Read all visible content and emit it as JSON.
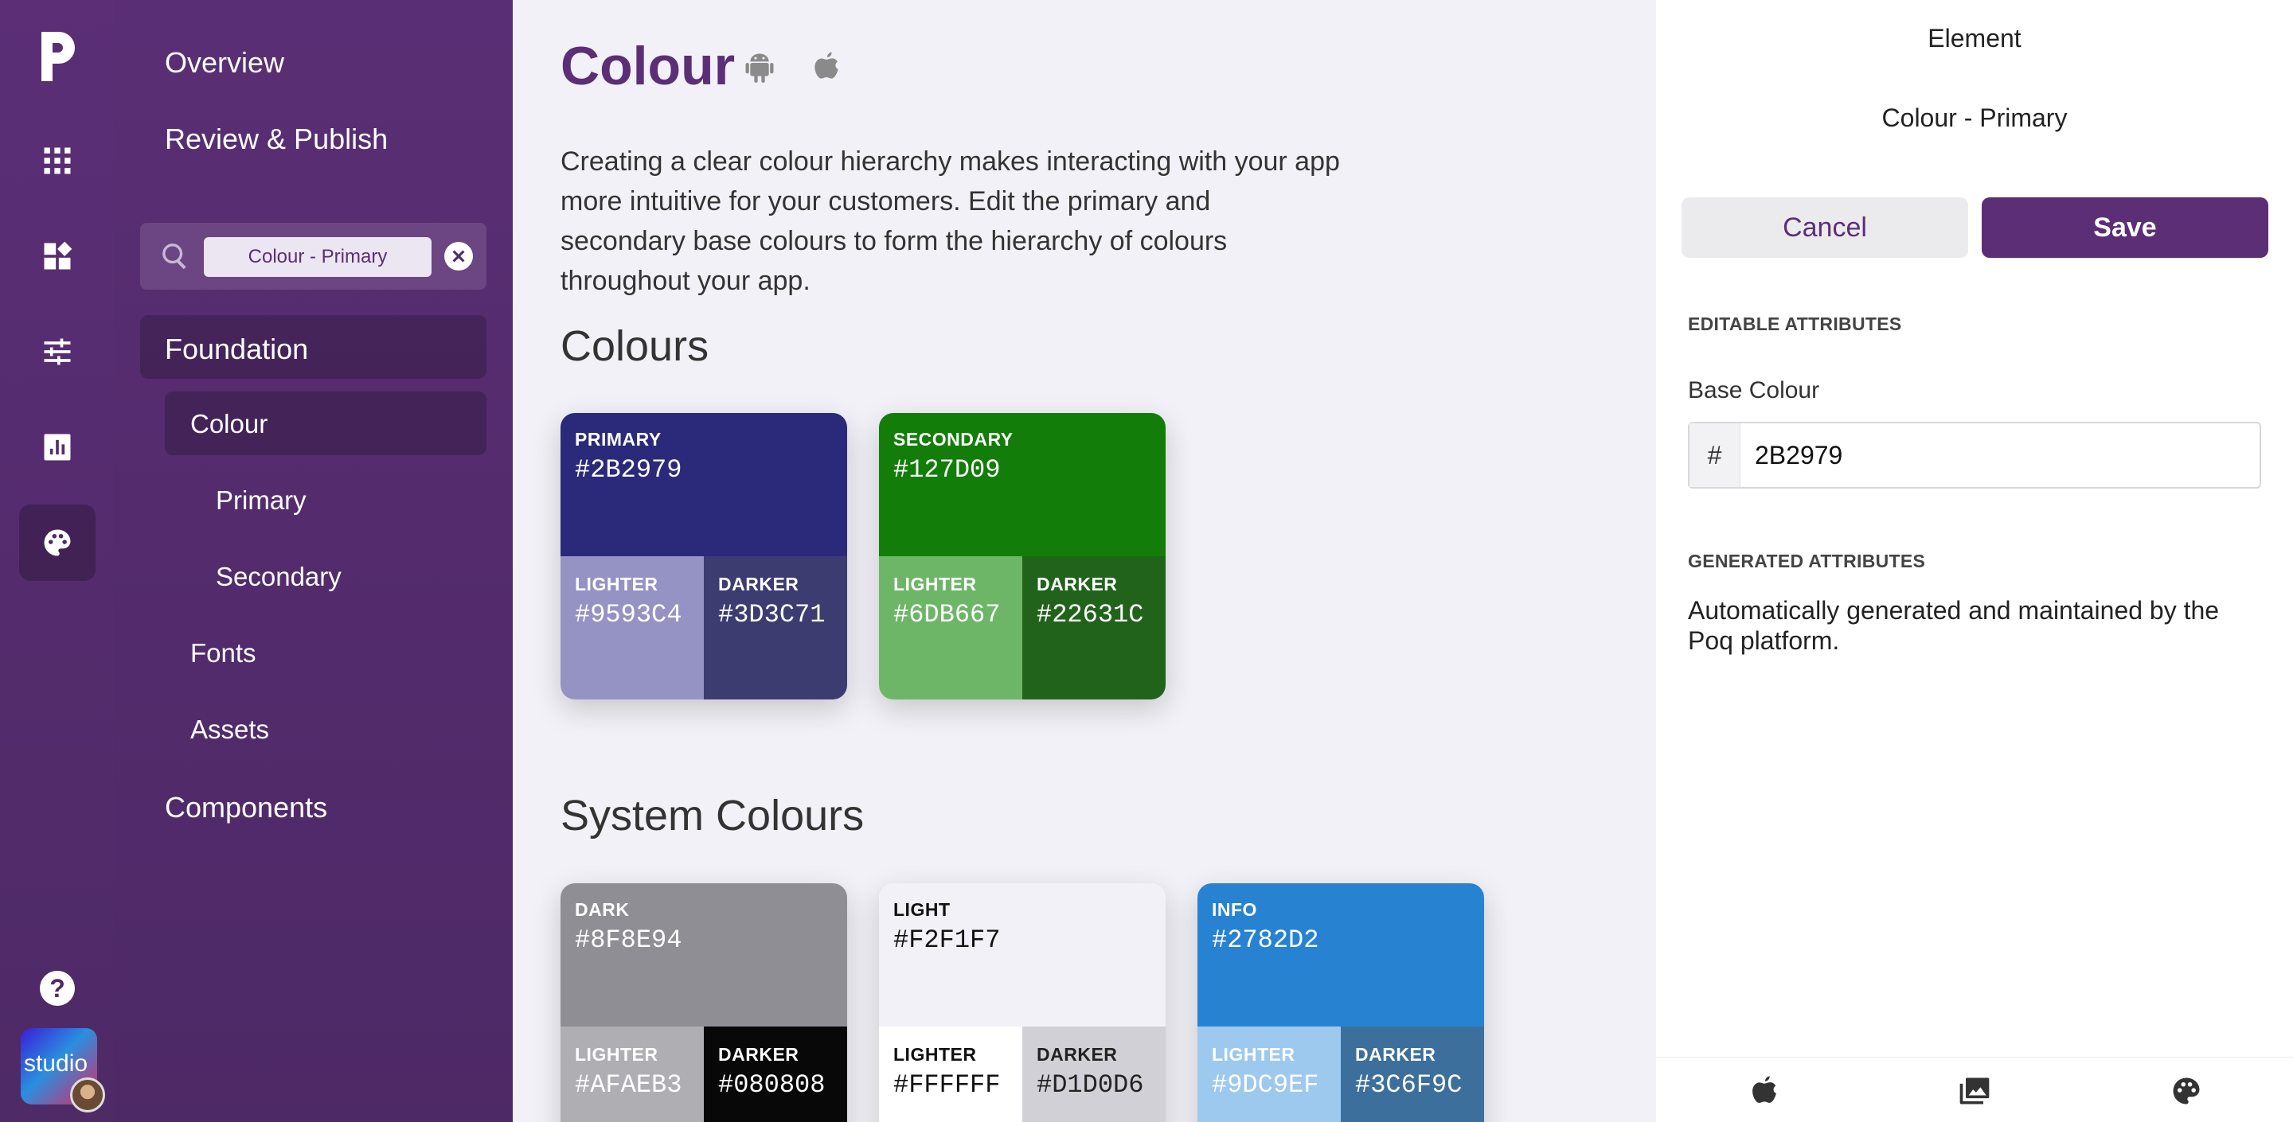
{
  "rail": {
    "logo": "poq-logo-icon",
    "items": [
      "apps-grid-icon",
      "dashboard-icon",
      "sliders-icon",
      "analytics-icon",
      "palette-icon"
    ],
    "help": "help-icon",
    "studio_badge": "studio"
  },
  "nav": {
    "overview": "Overview",
    "review_publish": "Review & Publish",
    "search_chip": "Colour - Primary",
    "foundation": "Foundation",
    "colour": "Colour",
    "primary": "Primary",
    "secondary": "Secondary",
    "fonts": "Fonts",
    "assets": "Assets",
    "components": "Components"
  },
  "main": {
    "title": "Colour",
    "intro": "Creating a clear colour hierarchy makes interacting with your app more intuitive for your customers. Edit the primary and secondary base colours to form the hierarchy of colours throughout your app.",
    "colours_heading": "Colours",
    "system_heading": "System Colours",
    "colours": [
      {
        "name": "PRIMARY",
        "hex": "#2B2979",
        "color": "#2B2979",
        "text": "#ffffff",
        "lighter": {
          "label": "LIGHTER",
          "hex": "#9593C4",
          "color": "#9593C4",
          "text": "#ffffff"
        },
        "darker": {
          "label": "DARKER",
          "hex": "#3D3C71",
          "color": "#3D3C71",
          "text": "#ffffff"
        }
      },
      {
        "name": "SECONDARY",
        "hex": "#127D09",
        "color": "#127D09",
        "text": "#ffffff",
        "lighter": {
          "label": "LIGHTER",
          "hex": "#6DB667",
          "color": "#6DB667",
          "text": "#ffffff"
        },
        "darker": {
          "label": "DARKER",
          "hex": "#22631C",
          "color": "#22631C",
          "text": "#ffffff"
        }
      }
    ],
    "system": [
      {
        "name": "DARK",
        "hex": "#8F8E94",
        "color": "#8F8E94",
        "text": "#ffffff",
        "lighter": {
          "label": "LIGHTER",
          "hex": "#AFAEB3",
          "color": "#AFAEB3",
          "text": "#ffffff"
        },
        "darker": {
          "label": "DARKER",
          "hex": "#080808",
          "color": "#080808",
          "text": "#ffffff"
        }
      },
      {
        "name": "LIGHT",
        "hex": "#F2F1F7",
        "color": "#F2F1F7",
        "text": "#111111",
        "lighter": {
          "label": "LIGHTER",
          "hex": "#FFFFFF",
          "color": "#FFFFFF",
          "text": "#111111"
        },
        "darker": {
          "label": "DARKER",
          "hex": "#D1D0D6",
          "color": "#D1D0D6",
          "text": "#222222"
        }
      },
      {
        "name": "INFO",
        "hex": "#2782D2",
        "color": "#2782D2",
        "text": "#ffffff",
        "lighter": {
          "label": "LIGHTER",
          "hex": "#9DC9EF",
          "color": "#9DC9EF",
          "text": "#ffffff"
        },
        "darker": {
          "label": "DARKER",
          "hex": "#3C6F9C",
          "color": "#3C6F9C",
          "text": "#ffffff"
        }
      }
    ]
  },
  "panel": {
    "heading": "Element",
    "subheading": "Colour - Primary",
    "cancel": "Cancel",
    "save": "Save",
    "editable_label": "EDITABLE ATTRIBUTES",
    "base_colour_label": "Base Colour",
    "hash": "#",
    "base_colour_value": "2B2979",
    "generated_label": "GENERATED ATTRIBUTES",
    "generated_text": "Automatically generated and maintained by the Poq platform.",
    "bottom_icons": [
      "apple-icon",
      "gallery-icon",
      "palette-icon"
    ]
  },
  "colors": {
    "brand": "#5B2E76"
  }
}
